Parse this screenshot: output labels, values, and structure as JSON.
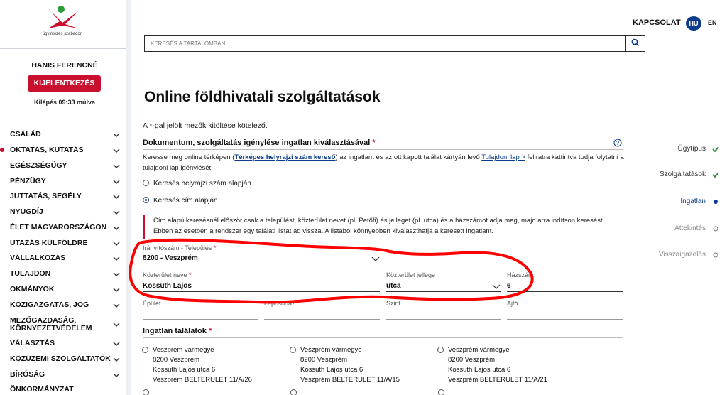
{
  "sidebar": {
    "logo_caption": "ügyintézés szabadon",
    "user_name": "HANIS FERENCNÉ",
    "logout_label": "KIJELENTKEZÉS",
    "logout_timer": "Kilépés 09:33 múlva",
    "nav": [
      {
        "label": "CSALÁD"
      },
      {
        "label": "OKTATÁS, KUTATÁS"
      },
      {
        "label": "EGÉSZSÉGÜGY"
      },
      {
        "label": "PÉNZÜGY"
      },
      {
        "label": "JUTTATÁS, SEGÉLY"
      },
      {
        "label": "NYUGDÍJ"
      },
      {
        "label": "ÉLET MAGYARORSZÁGON"
      },
      {
        "label": "UTAZÁS KÜLFÖLDRE"
      },
      {
        "label": "VÁLLALKOZÁS"
      },
      {
        "label": "TULAJDON"
      },
      {
        "label": "OKMÁNYOK"
      },
      {
        "label": "KÖZIGAZGATÁS, JOG"
      },
      {
        "label_line1": "MEZŐGAZDASÁG,",
        "label_line2": "KÖRNYEZETVÉDELEM"
      },
      {
        "label": "VÁLASZTÁS"
      },
      {
        "label": "KÖZÜZEMI SZOLGÁLTATÓK"
      },
      {
        "label": "BÍRÓSÁG"
      },
      {
        "label": "ÖNKORMÁNYZAT"
      }
    ]
  },
  "header": {
    "contact": "KAPCSOLAT",
    "lang_active": "HU",
    "lang_other": "EN",
    "search_placeholder": "KERESÉS A TARTALOMBAN"
  },
  "main": {
    "title": "Online földhivatali szolgáltatások",
    "required_note": "A *-gal jelölt mezők kitöltése kötelező.",
    "doc_section_title": "Dokumentum, szolgáltatás igénylése ingatlan kiválasztásával",
    "req_mark": "*",
    "instruction_1": "Keresse meg online térképen (",
    "instruction_link1": "Térképes helyrajzi szám kereső",
    "instruction_2": ") az ingatlant és az ott kapott találat kártyán levő ",
    "instruction_link2": "Tulajdoni lap >",
    "instruction_3": " feliratra kattintva tudja folytatni a tulajdoni lap igénylését!",
    "radio_hrsz": "Keresés helyrajzi szám alapján",
    "radio_cim": "Keresés cím alapján",
    "info_text": "Cím alapú keresésnél először csak a települést, közterület nevet (pl. Petőfi) és jelleget (pl. utca) és a házszámot adja meg, majd arra indítson keresést. Ebben az esetben a rendszer egy találati listát ad vissza. A listából könnyebben kiválaszthatja a keresett ingatlant.",
    "fields": {
      "zip_city_label": "Irányítószám - Település",
      "zip_city_value": "8200 - Veszprém",
      "street_name_label": "Közterület neve",
      "street_name_value": "Kossuth Lajos",
      "street_type_label": "Közterület jellege",
      "street_type_value": "utca",
      "house_no_label": "Házszám",
      "house_no_value": "6",
      "building_label": "Épület",
      "stair_label": "Lépcsőház",
      "floor_label": "Szint",
      "door_label": "Ajtó"
    },
    "results_title": "Ingatlan találatok",
    "results": [
      {
        "line1": "Veszprém vármegye",
        "line2": "8200 Veszprém",
        "line3": "Kossuth Lajos utca 6",
        "line4": "Veszprém BELTERULET 11/A/26"
      },
      {
        "line1": "Veszprém vármegye",
        "line2": "8200 Veszprém",
        "line3": "Kossuth Lajos utca 6",
        "line4": "Veszprém BELTERULET 11/A/15"
      },
      {
        "line1": "Veszprém vármegye",
        "line2": "8200 Veszprém",
        "line3": "Kossuth Lajos utca 6",
        "line4": "Veszprém BELTERULET 11/A/21"
      }
    ]
  },
  "stepper": [
    {
      "label": "Ügytípus",
      "state": "done"
    },
    {
      "label": "Szolgáltatások",
      "state": "done"
    },
    {
      "label": "Ingatlan",
      "state": "active"
    },
    {
      "label": "Áttekintés",
      "state": "pending"
    },
    {
      "label": "Visszaigazolás",
      "state": "pending"
    }
  ],
  "colors": {
    "brand_red": "#c8102e",
    "brand_blue": "#0a3b8c",
    "check_green": "#2e8b2e",
    "annotation_red": "#ff0000"
  }
}
